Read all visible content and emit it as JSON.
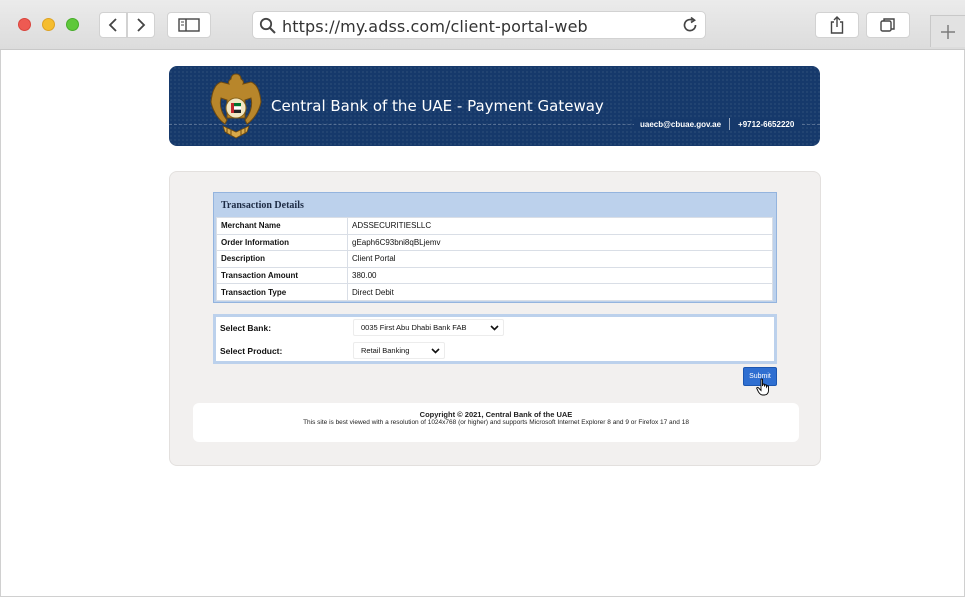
{
  "browser": {
    "url": "https://my.adss.com/client-portal-web"
  },
  "banner": {
    "title": "Central Bank of the UAE - Payment Gateway",
    "email": "uaecb@cbuae.gov.ae",
    "phone": "+9712-6652220"
  },
  "transaction": {
    "header": "Transaction Details",
    "rows": [
      {
        "label": "Merchant Name",
        "value": "ADSSECURITIESLLC"
      },
      {
        "label": "Order Information",
        "value": "gEaph6C93bni8qBLjemv"
      },
      {
        "label": "Description",
        "value": "Client Portal"
      },
      {
        "label": "Transaction Amount",
        "value": "380.00"
      },
      {
        "label": "Transaction Type",
        "value": "Direct Debit"
      }
    ]
  },
  "selection": {
    "bank_label": "Select Bank:",
    "bank_value": "0035 First Abu Dhabi Bank FAB",
    "product_label": "Select Product:",
    "product_value": "Retail Banking"
  },
  "submit_label": "Submit",
  "footer": {
    "copyright": "Copyright © 2021, Central Bank of the UAE",
    "note": "This site is best viewed with a resolution of 1024x768 (or higher) and supports Microsoft Internet Explorer 8 and 9 or Firefox 17 and 18"
  },
  "colors": {
    "banner": "#16396b",
    "panel": "#f2f0ef",
    "tx_box": "#bcd1ec",
    "submit": "#2f6fd1"
  }
}
